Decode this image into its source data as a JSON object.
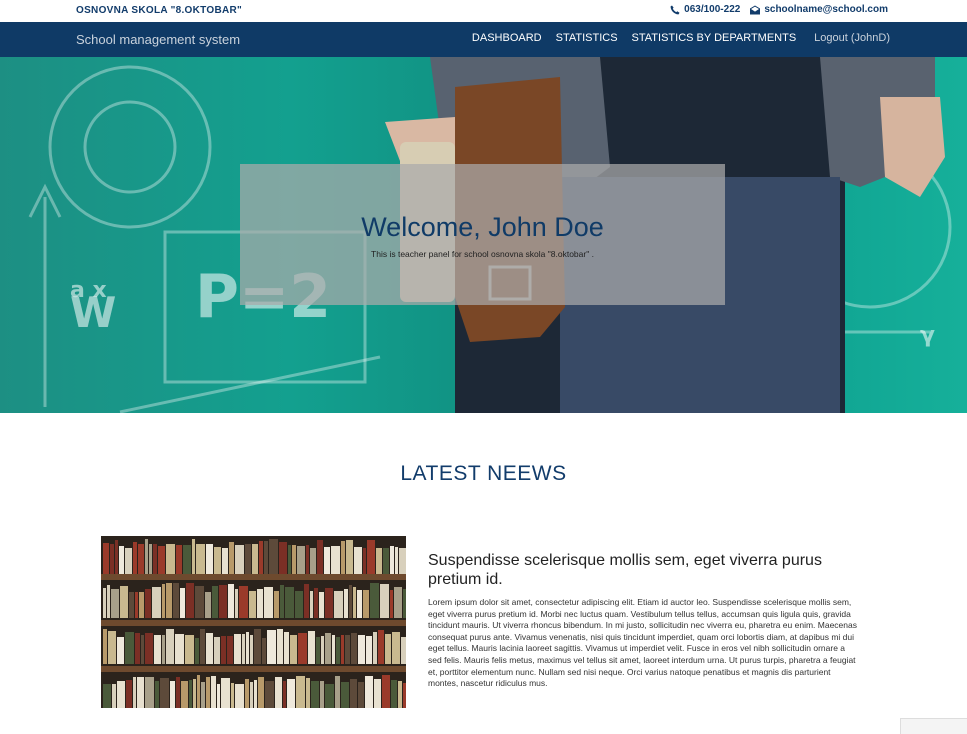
{
  "topbar": {
    "school_name": "OSNOVNA SKOLA \"8.OKTOBAR\"",
    "phone": "063/100-222",
    "email": "schoolname@school.com",
    "phone_icon": "phone-icon",
    "email_icon": "envelope-icon"
  },
  "navbar": {
    "brand": "School management system",
    "links": [
      "DASHBOARD",
      "STATISTICS",
      "STATISTICS BY DEPARTMENTS"
    ],
    "logout": "Logout (JohnD)"
  },
  "hero": {
    "title": "Welcome, John Doe",
    "subtitle": "This is teacher panel for school osnovna skola \"8.oktobar\" ."
  },
  "news": {
    "section_title": "LATEST NEEWS",
    "items": [
      {
        "title": "Suspendisse scelerisque mollis sem, eget viverra purus pretium id.",
        "body": "Lorem ipsum dolor sit amet, consectetur adipiscing elit. Etiam id auctor leo. Suspendisse scelerisque mollis sem, eget viverra purus pretium id. Morbi nec luctus quam. Vestibulum tellus tellus, accumsan quis ligula quis, gravida tincidunt mauris. Ut viverra rhoncus bibendum. In mi justo, sollicitudin nec viverra eu, pharetra eu enim. Maecenas consequat purus ante. Vivamus venenatis, nisi quis tincidunt imperdiet, quam orci lobortis diam, at dapibus mi dui eget tellus. Mauris lacinia laoreet sagittis. Vivamus ut imperdiet velit. Fusce in eros vel nibh sollicitudin ornare a sed felis. Mauris felis metus, maximus vel tellus sit amet, laoreet interdum urna. Ut purus turpis, pharetra a feugiat et, porttitor elementum nunc. Nullam sed nisi neque. Orci varius natoque penatibus et magnis dis parturient montes, nascetur ridiculus mus."
      }
    ]
  },
  "colors": {
    "navy": "#0f3a66",
    "teal": "#13a08f",
    "text_dark": "#123c6b"
  }
}
